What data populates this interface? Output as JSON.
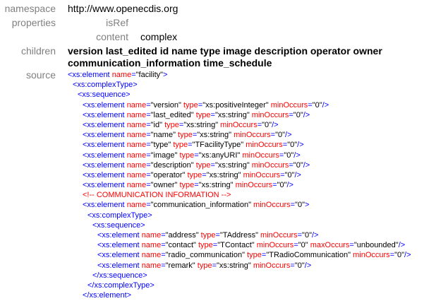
{
  "labels": {
    "namespace": "namespace",
    "properties": "properties",
    "isRef": "isRef",
    "content": "content",
    "children": "children",
    "source": "source"
  },
  "values": {
    "namespace": "http://www.openecdis.org",
    "isRef": "",
    "content": "complex",
    "children_line1": "version last_edited id name type image description operator owner",
    "children_line2": "communication_information time_schedule"
  },
  "source_lines": [
    {
      "indent": 0,
      "tag": "<xs:element",
      "attrs": [
        [
          "name",
          "\"facility\""
        ]
      ],
      "close": ">"
    },
    {
      "indent": 1,
      "tag": "<xs:complexType>",
      "attrs": [],
      "close": ""
    },
    {
      "indent": 2,
      "tag": "<xs:sequence>",
      "attrs": [],
      "close": ""
    },
    {
      "indent": 3,
      "tag": "<xs:element",
      "attrs": [
        [
          "name",
          "\"version\""
        ],
        [
          "type",
          "\"xs:positiveInteger\""
        ],
        [
          "minOccurs",
          "\"0\""
        ]
      ],
      "close": "/>"
    },
    {
      "indent": 3,
      "tag": "<xs:element",
      "attrs": [
        [
          "name",
          "\"last_edited\""
        ],
        [
          "type",
          "\"xs:string\""
        ],
        [
          "minOccurs",
          "\"0\""
        ]
      ],
      "close": "/>"
    },
    {
      "indent": 3,
      "tag": "<xs:element",
      "attrs": [
        [
          "name",
          "\"id\""
        ],
        [
          "type",
          "\"xs:string\""
        ],
        [
          "minOccurs",
          "\"0\""
        ]
      ],
      "close": "/>"
    },
    {
      "indent": 3,
      "tag": "<xs:element",
      "attrs": [
        [
          "name",
          "\"name\""
        ],
        [
          "type",
          "\"xs:string\""
        ],
        [
          "minOccurs",
          "\"0\""
        ]
      ],
      "close": "/>"
    },
    {
      "indent": 3,
      "tag": "<xs:element",
      "attrs": [
        [
          "name",
          "\"type\""
        ],
        [
          "type",
          "\"TFacilityType\""
        ],
        [
          "minOccurs",
          "\"0\""
        ]
      ],
      "close": "/>"
    },
    {
      "indent": 3,
      "tag": "<xs:element",
      "attrs": [
        [
          "name",
          "\"image\""
        ],
        [
          "type",
          "\"xs:anyURI\""
        ],
        [
          "minOccurs",
          "\"0\""
        ]
      ],
      "close": "/>"
    },
    {
      "indent": 3,
      "tag": "<xs:element",
      "attrs": [
        [
          "name",
          "\"description\""
        ],
        [
          "type",
          "\"xs:string\""
        ],
        [
          "minOccurs",
          "\"0\""
        ]
      ],
      "close": "/>"
    },
    {
      "indent": 3,
      "tag": "<xs:element",
      "attrs": [
        [
          "name",
          "\"operator\""
        ],
        [
          "type",
          "\"xs:string\""
        ],
        [
          "minOccurs",
          "\"0\""
        ]
      ],
      "close": "/>"
    },
    {
      "indent": 3,
      "tag": "<xs:element",
      "attrs": [
        [
          "name",
          "\"owner\""
        ],
        [
          "type",
          "\"xs:string\""
        ],
        [
          "minOccurs",
          "\"0\""
        ]
      ],
      "close": "/>"
    },
    {
      "indent": 3,
      "comment": "<!-- COMMUNICATION INFORMATION -->"
    },
    {
      "indent": 3,
      "tag": "<xs:element",
      "attrs": [
        [
          "name",
          "\"communication_information\""
        ],
        [
          "minOccurs",
          "\"0\""
        ]
      ],
      "close": ">"
    },
    {
      "indent": 4,
      "tag": "<xs:complexType>",
      "attrs": [],
      "close": ""
    },
    {
      "indent": 5,
      "tag": "<xs:sequence>",
      "attrs": [],
      "close": ""
    },
    {
      "indent": 6,
      "tag": "<xs:element",
      "attrs": [
        [
          "name",
          "\"address\""
        ],
        [
          "type",
          "\"TAddress\""
        ],
        [
          "minOccurs",
          "\"0\""
        ]
      ],
      "close": "/>"
    },
    {
      "indent": 6,
      "tag": "<xs:element",
      "attrs": [
        [
          "name",
          "\"contact\""
        ],
        [
          "type",
          "\"TContact\""
        ],
        [
          "minOccurs",
          "\"0\""
        ],
        [
          "maxOccurs",
          "\"unbounded\""
        ]
      ],
      "close": "/>"
    },
    {
      "indent": 6,
      "tag": "<xs:element",
      "attrs": [
        [
          "name",
          "\"radio_communication\""
        ],
        [
          "type",
          "\"TRadioCommunication\""
        ],
        [
          "minOccurs",
          "\"0\""
        ]
      ],
      "close": "/>"
    },
    {
      "indent": 6,
      "tag": "<xs:element",
      "attrs": [
        [
          "name",
          "\"remark\""
        ],
        [
          "type",
          "\"xs:string\""
        ],
        [
          "minOccurs",
          "\"0\""
        ]
      ],
      "close": "/>"
    },
    {
      "indent": 5,
      "tag": "</xs:sequence>",
      "attrs": [],
      "close": ""
    },
    {
      "indent": 4,
      "tag": "</xs:complexType>",
      "attrs": [],
      "close": ""
    },
    {
      "indent": 3,
      "tag": "</xs:element>",
      "attrs": [],
      "close": ""
    }
  ],
  "colors": {
    "label": "#808080",
    "tag": "#0000ff",
    "attr_name": "#ff0000",
    "attr_value": "#000000",
    "comment": "#ff0000"
  }
}
